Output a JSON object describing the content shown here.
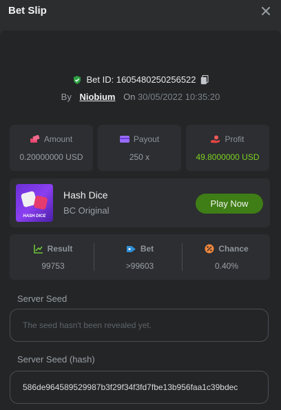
{
  "header": {
    "title": "Bet Slip"
  },
  "bet": {
    "id_label": "Bet ID: 1605480250256522",
    "by_label": "By",
    "user": "Niobium",
    "on_label": "On",
    "date": "30/05/2022 10:35:20"
  },
  "stats": [
    {
      "label": "Amount",
      "value": "0.20000000 USD",
      "icon": "money-icon"
    },
    {
      "label": "Payout",
      "value": "250 x",
      "icon": "wallet-icon"
    },
    {
      "label": "Profit",
      "value": "49.8000000 USD",
      "icon": "hand-coin-icon"
    }
  ],
  "game": {
    "name": "Hash Dice",
    "subtitle": "BC Original",
    "play_label": "Play Now",
    "thumb_caption": "HASH DICE"
  },
  "result": {
    "result_label": "Result",
    "result_value": "99753",
    "bet_label": "Bet",
    "bet_value": ">99603",
    "chance_label": "Chance",
    "chance_value": "0.40%"
  },
  "server_seed": {
    "label": "Server Seed",
    "placeholder": "The seed hasn't been revealed yet."
  },
  "server_seed_hash": {
    "label": "Server Seed (hash)",
    "value": "586de964589529987b3f29f34f3fd7fbe13b956faa1c39bdec"
  },
  "colors": {
    "accent_green": "#3f7d16",
    "profit_green": "#7ed321",
    "background": "#232527"
  }
}
